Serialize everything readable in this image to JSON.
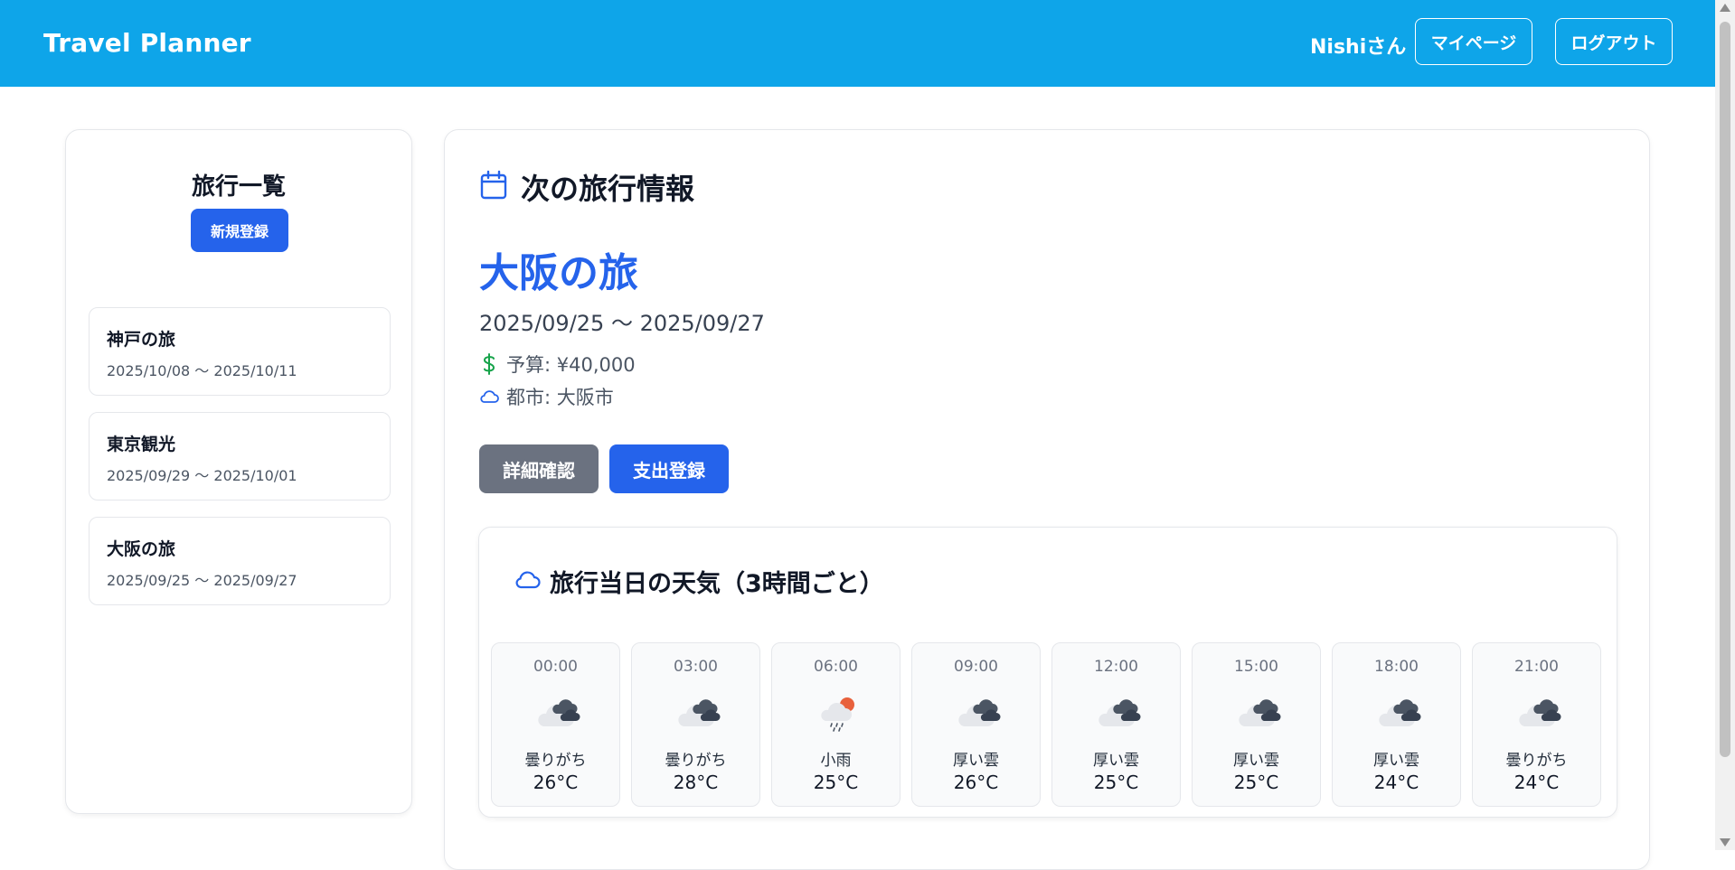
{
  "header": {
    "brand": "Travel Planner",
    "user": "Nishiさん",
    "mypage_label": "マイページ",
    "logout_label": "ログアウト"
  },
  "sidebar": {
    "title": "旅行一覧",
    "new_label": "新規登録",
    "trips": [
      {
        "name": "神戸の旅",
        "dates": "2025/10/08 〜 2025/10/11"
      },
      {
        "name": "東京観光",
        "dates": "2025/09/29 〜 2025/10/01"
      },
      {
        "name": "大阪の旅",
        "dates": "2025/09/25 〜 2025/09/27"
      }
    ]
  },
  "main": {
    "section_title": "次の旅行情報",
    "trip_title": "大阪の旅",
    "trip_range": "2025/09/25 〜 2025/09/27",
    "budget": "予算: ¥40,000",
    "city": "都市: 大阪市",
    "detail_label": "詳細確認",
    "expense_label": "支出登録"
  },
  "weather": {
    "title": "旅行当日の天気（3時間ごと）",
    "hours": [
      {
        "time": "00:00",
        "desc": "曇りがち",
        "temp": "26°C",
        "icon": "broken-clouds-icon"
      },
      {
        "time": "03:00",
        "desc": "曇りがち",
        "temp": "28°C",
        "icon": "broken-clouds-icon"
      },
      {
        "time": "06:00",
        "desc": "小雨",
        "temp": "25°C",
        "icon": "light-rain-icon"
      },
      {
        "time": "09:00",
        "desc": "厚い雲",
        "temp": "26°C",
        "icon": "overcast-clouds-icon"
      },
      {
        "time": "12:00",
        "desc": "厚い雲",
        "temp": "25°C",
        "icon": "overcast-clouds-icon"
      },
      {
        "time": "15:00",
        "desc": "厚い雲",
        "temp": "25°C",
        "icon": "overcast-clouds-icon"
      },
      {
        "time": "18:00",
        "desc": "厚い雲",
        "temp": "24°C",
        "icon": "overcast-clouds-icon"
      },
      {
        "time": "21:00",
        "desc": "曇りがち",
        "temp": "24°C",
        "icon": "broken-clouds-icon"
      }
    ]
  },
  "colors": {
    "header": "#0ea5e9",
    "accent": "#2563eb",
    "secondary_button": "#6b7280",
    "budget_icon": "#16a34a"
  }
}
